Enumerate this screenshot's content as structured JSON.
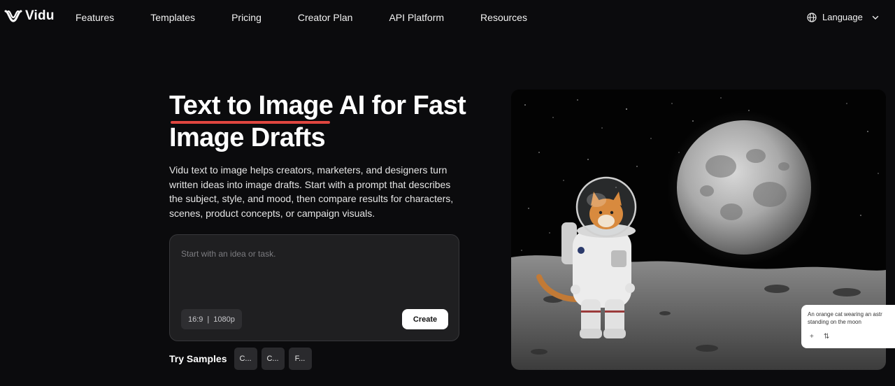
{
  "brand": {
    "name": "Vidu"
  },
  "nav": {
    "links": [
      "Features",
      "Templates",
      "Pricing",
      "Creator Plan",
      "API Platform",
      "Resources"
    ],
    "language_label": "Language"
  },
  "hero": {
    "title_line1_highlight": "Text to Image",
    "title_line1_rest": " AI for Fast",
    "title_line2": "Image Drafts",
    "description": "Vidu text to image helps creators, marketers, and designers turn written ideas into image drafts. Start with a prompt that describes the subject, style, and mood, then compare results for characters, scenes, product concepts, or campaign visuals.",
    "prompt_placeholder": "Start with an idea or task.",
    "aspect_ratio": "16:9",
    "separator": "|",
    "resolution": "1080p",
    "create_label": "Create",
    "samples_label": "Try Samples",
    "samples": [
      "C...",
      "C...",
      "F..."
    ]
  },
  "preview": {
    "caption_line1": "An orange cat wearing an astr",
    "caption_line2": "standing on the moon",
    "caption_icons": [
      "plus-icon",
      "swap-icon"
    ]
  },
  "colors": {
    "background": "#0b0b0d",
    "accent_underline": "#e0463f",
    "prompt_box": "#1f1f21"
  }
}
